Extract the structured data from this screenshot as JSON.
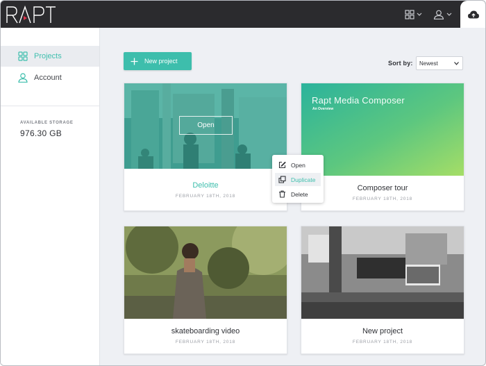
{
  "app": {
    "logo_text": "RAPT"
  },
  "topbar": {
    "grid_icon": "grid-icon",
    "user_icon": "user-icon",
    "upload_icon": "cloud-upload-icon"
  },
  "sidebar": {
    "items": [
      {
        "label": "Projects",
        "icon": "grid-icon",
        "active": true
      },
      {
        "label": "Account",
        "icon": "user-icon",
        "active": false
      }
    ],
    "storage_label": "AVAILABLE STORAGE",
    "storage_value": "976.30 GB"
  },
  "toolbar": {
    "new_project_label": "New project",
    "sort_label": "Sort by:",
    "sort_selected": "Newest"
  },
  "cards": [
    {
      "title": "Deloitte",
      "date": "FEBRUARY 18TH, 2018",
      "hover_label": "Open"
    },
    {
      "title": "Composer tour",
      "date": "FEBRUARY 18TH, 2018",
      "thumb_title": "Rapt Media Composer",
      "thumb_subtitle": "An Overview"
    },
    {
      "title": "skateboarding video",
      "date": "FEBRUARY 18TH, 2018"
    },
    {
      "title": "New project",
      "date": "FEBRUARY 18TH, 2018"
    }
  ],
  "context_menu": {
    "items": [
      {
        "label": "Open",
        "icon": "edit-icon"
      },
      {
        "label": "Duplicate",
        "icon": "duplicate-icon"
      },
      {
        "label": "Delete",
        "icon": "trash-icon"
      }
    ]
  },
  "colors": {
    "accent": "#3dbeac",
    "topbar": "#2b2b2e",
    "background": "#eef0f4"
  }
}
